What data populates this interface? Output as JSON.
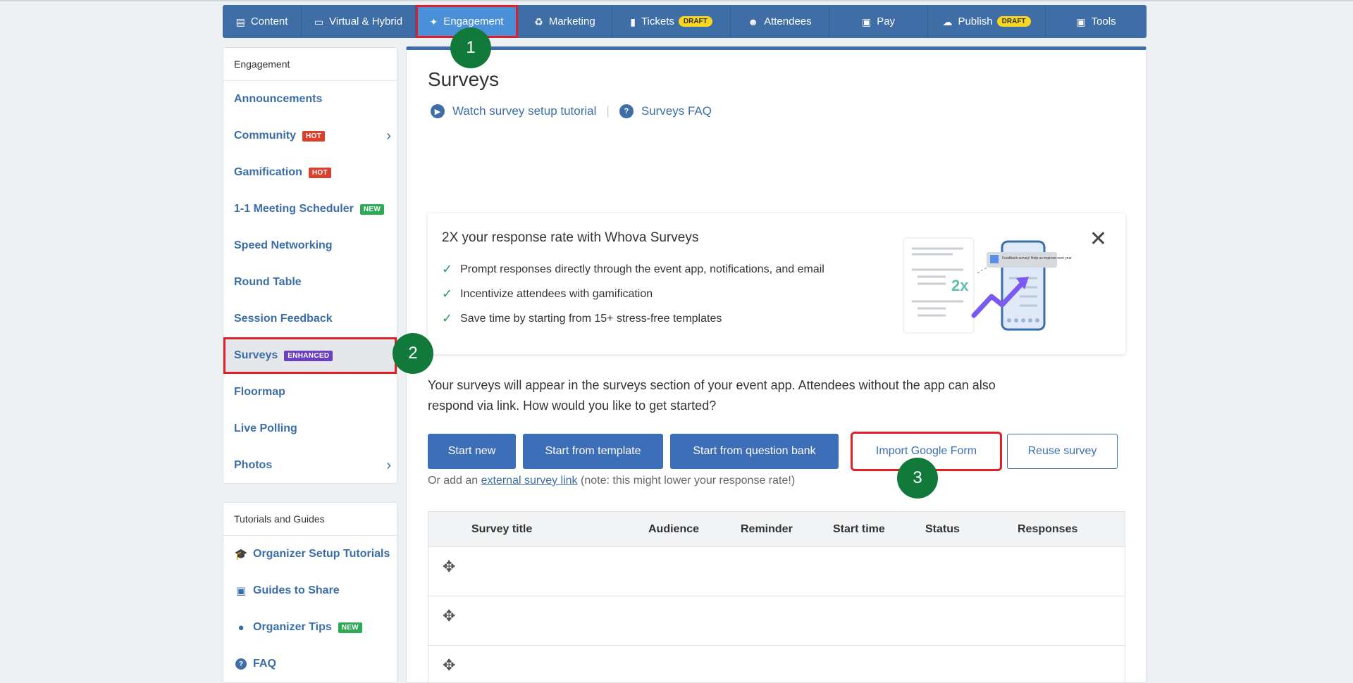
{
  "topnav": {
    "items": [
      {
        "label": "Content",
        "icon": "list-icon"
      },
      {
        "label": "Virtual & Hybrid",
        "icon": "laptop-icon"
      },
      {
        "label": "Engagement",
        "icon": "network-icon"
      },
      {
        "label": "Marketing",
        "icon": "megaphone-icon"
      },
      {
        "label": "Tickets",
        "icon": "ticket-icon",
        "badge": "DRAFT"
      },
      {
        "label": "Attendees",
        "icon": "people-icon"
      },
      {
        "label": "Pay",
        "icon": "card-icon"
      },
      {
        "label": "Publish",
        "icon": "cloud-upload-icon",
        "badge": "DRAFT"
      },
      {
        "label": "Tools",
        "icon": "toolbox-icon"
      }
    ]
  },
  "callouts": [
    "1",
    "2",
    "3"
  ],
  "sidebar": {
    "header": "Engagement",
    "items": [
      {
        "label": "Announcements"
      },
      {
        "label": "Community",
        "badge": "HOT"
      },
      {
        "label": "Gamification",
        "badge": "HOT"
      },
      {
        "label": "1-1 Meeting Scheduler",
        "badge": "NEW"
      },
      {
        "label": "Speed Networking"
      },
      {
        "label": "Round Table"
      },
      {
        "label": "Session Feedback"
      },
      {
        "label": "Surveys",
        "badge": "ENHANCED"
      },
      {
        "label": "Floormap"
      },
      {
        "label": "Live Polling"
      },
      {
        "label": "Photos"
      }
    ]
  },
  "guides": {
    "header": "Tutorials and Guides",
    "items": [
      {
        "label": "Organizer Setup Tutorials",
        "icon": "graduation-cap-icon"
      },
      {
        "label": "Guides to Share",
        "icon": "presentation-icon"
      },
      {
        "label": "Organizer Tips",
        "icon": "lightbulb-icon",
        "badge": "NEW"
      },
      {
        "label": "FAQ",
        "icon": "question-circle-icon"
      }
    ]
  },
  "main": {
    "title": "Surveys",
    "tutorial_link": "Watch survey setup tutorial",
    "faq_link": "Surveys FAQ",
    "promo": {
      "title": "2X your response rate with Whova Surveys",
      "bullets": [
        "Prompt responses directly through the event app, notifications, and email",
        "Incentivize attendees with gamification",
        "Save time by starting from 15+ stress-free templates"
      ],
      "art_text": "Feedback survey! Help us improve next year",
      "art_multiplier": "2x"
    },
    "intro": "Your surveys will appear in the surveys section of your event app. Attendees without the app can also respond via link. How would you like to get started?",
    "buttons": {
      "start_new": "Start new",
      "start_template": "Start from template",
      "start_bank": "Start from question bank",
      "import_google": "Import Google Form",
      "reuse": "Reuse survey"
    },
    "ext_prefix": "Or add an ",
    "ext_link": "external survey link",
    "ext_suffix": " (note: this might lower your response rate!)",
    "table": {
      "columns": [
        "Survey title",
        "Audience",
        "Reminder",
        "Start time",
        "Status",
        "Responses"
      ],
      "rows": 3
    }
  }
}
